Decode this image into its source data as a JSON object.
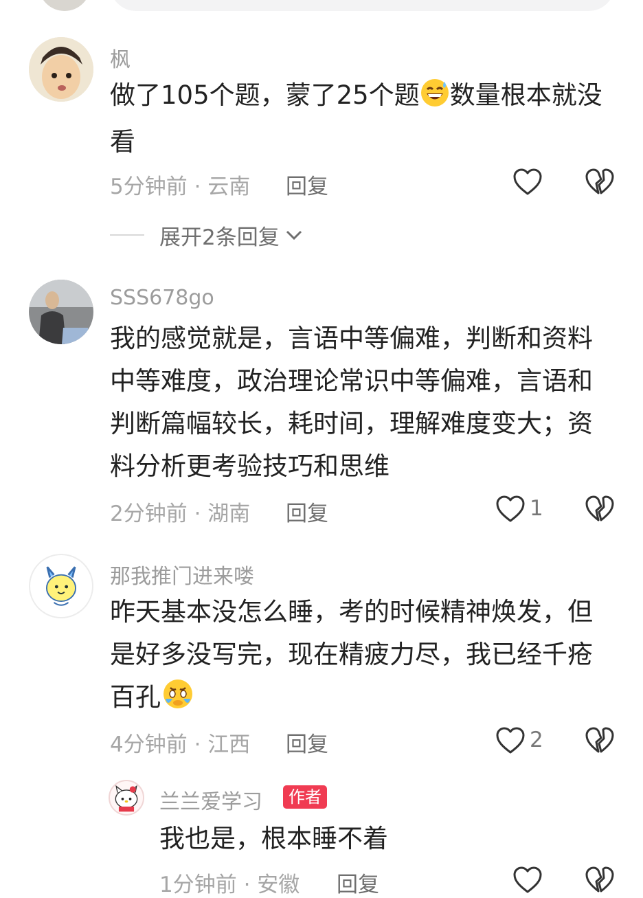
{
  "comments": [
    {
      "username": "枫",
      "text_part1": "做了105个题，蒙了25个题",
      "emoji": "grin-sweat",
      "text_part2": "数量根本就没看",
      "time_loc": "5分钟前 · 云南",
      "reply_label": "回复",
      "likes": ""
    },
    {
      "username": "SSS678go",
      "text": "我的感觉就是，言语中等偏难，判断和资料中等难度，政治理论常识中等偏难，言语和判断篇幅较长，耗时间，理解难度变大；资料分析更考验技巧和思维",
      "time_loc": "2分钟前 · 湖南",
      "reply_label": "回复",
      "likes": "1"
    },
    {
      "username": "那我推门进来喽",
      "text_part1": "昨天基本没怎么睡，考的时候精神焕发，但是好多没写完，现在精疲力尽，我已经千疮百孔",
      "emoji": "crying-face",
      "time_loc": "4分钟前 · 江西",
      "reply_label": "回复",
      "likes": "2"
    }
  ],
  "expand_replies": "展开2条回复",
  "reply": {
    "username": "兰兰爱学习",
    "badge": "作者",
    "text": "我也是，根本睡不着",
    "time_loc": "1分钟前 · 安徽",
    "reply_label": "回复",
    "likes": ""
  },
  "icons": {
    "like": "heart-outline-icon",
    "dislike": "broken-heart-icon",
    "expand": "chevron-down-icon"
  },
  "colors": {
    "username": "#9c9c9c",
    "text": "#222222",
    "meta": "#a6a6a6",
    "author_badge": "#f03b52"
  }
}
